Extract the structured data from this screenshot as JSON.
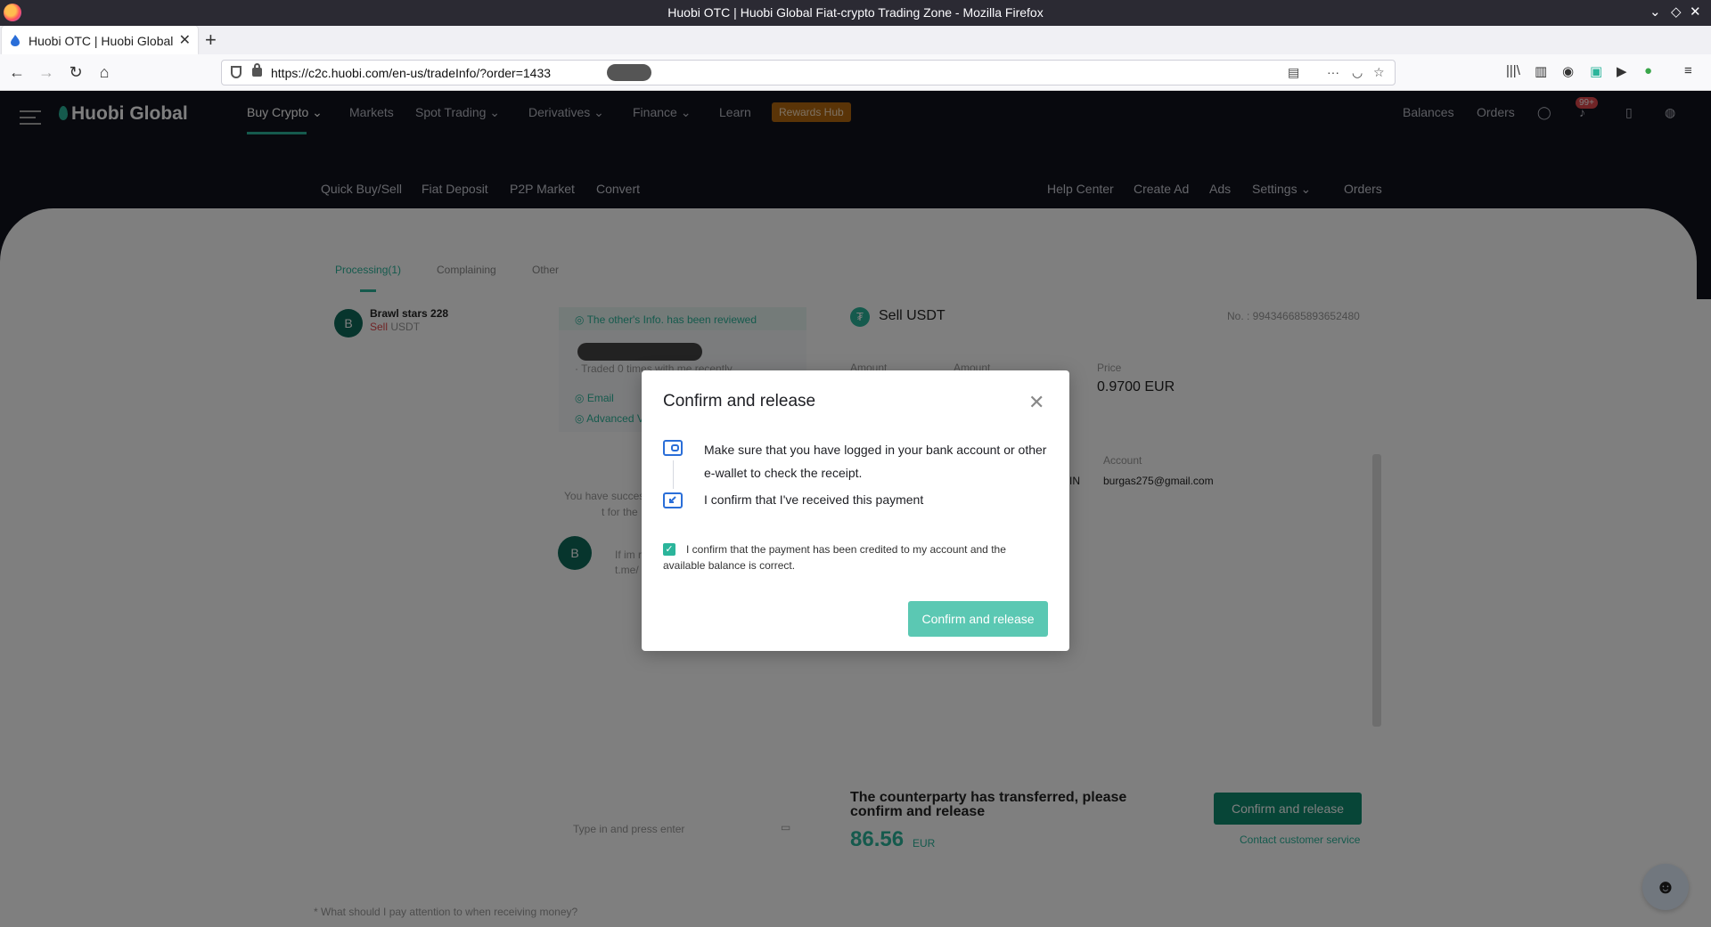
{
  "browser": {
    "window_title": "Huobi OTC | Huobi Global Fiat-crypto Trading Zone - Mozilla Firefox",
    "tab_title": "Huobi OTC | Huobi Global",
    "url": "https://c2c.huobi.com/en-us/tradeInfo/?order=1433"
  },
  "topnav": {
    "logo": "Huobi Global",
    "items": [
      "Buy Crypto",
      "Markets",
      "Spot Trading",
      "Derivatives",
      "Finance",
      "Learn"
    ],
    "rewards": "Rewards Hub",
    "right": [
      "Balances",
      "Orders"
    ],
    "badge": "99+"
  },
  "subnav": {
    "left": [
      "Quick Buy/Sell",
      "Fiat Deposit",
      "P2P Market",
      "Convert"
    ],
    "right": [
      "Help Center",
      "Create Ad",
      "Ads",
      "Settings",
      "Orders"
    ]
  },
  "order_tabs": [
    "Processing(1)",
    "Complaining",
    "Other"
  ],
  "order_list": {
    "name": "Brawl stars 228",
    "side": "Sell",
    "asset": "USDT",
    "avatar": "B"
  },
  "chat": {
    "reviewed": "The other's Info. has been reviewed",
    "traded": "· Traded 0 times with me recently",
    "email": "Email",
    "advanced": "Advanced V",
    "success_1": "You have succes",
    "success_2": "t for the",
    "msg_1": "If im r",
    "msg_2": "t.me/",
    "placeholder": "Type in and press enter"
  },
  "order_detail": {
    "title": "Sell USDT",
    "order_no": "No. : 994346685893652480",
    "amount_label": "Amount",
    "amount_label2": "Amount",
    "price_label": "Price",
    "price": "0.9700 EUR",
    "account_label": "Account",
    "account": "burgas275@gmail.com",
    "in_suffix": "IN",
    "status": "The counterparty has transferred, please confirm and release",
    "total": "86.56",
    "currency": "EUR",
    "confirm_button": "Confirm and release",
    "contact": "Contact customer service"
  },
  "footer_note": "* What should I pay attention to when receiving money?",
  "modal": {
    "title": "Confirm and release",
    "step1": "Make sure that you have logged in your bank account or other e-wallet to check the receipt.",
    "step2": "I confirm that I've received this payment",
    "checkbox_label": "I confirm that the payment has been credited to my account and the available balance is correct.",
    "button": "Confirm and release"
  },
  "colors": {
    "accent": "#2bb59b",
    "brand_dark": "#11131d",
    "sell_red": "#e0484c",
    "modal_button": "#5bc8b3",
    "step_icon_blue": "#2a6ed8"
  }
}
